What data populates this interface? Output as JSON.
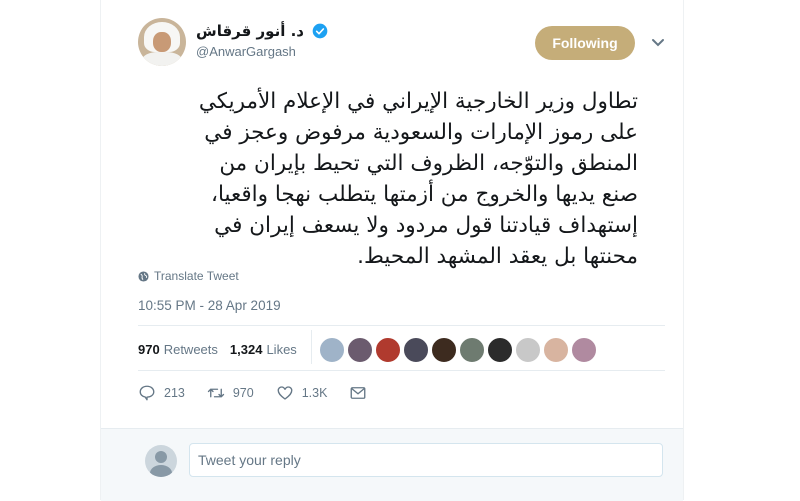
{
  "author": {
    "display_name": "د. أنور قرقاش",
    "handle": "@AnwarGargash",
    "verified": true,
    "avatar_icon": "profile-photo"
  },
  "follow_button": {
    "label": "Following",
    "color": "#c5ad79"
  },
  "tweet": {
    "lines": [
      "تطاول وزير الخارجية الإيراني في الإعلام الأمريكي",
      "على رموز الإمارات والسعودية مرفوض وعجز في",
      "المنطق والتوّجه، الظروف التي تحيط بإيران من",
      "صنع يديها والخروج من أزمتها يتطلب نهجا واقعيا،",
      "إستهداف قيادتنا قول مردود ولا يسعف إيران في",
      "محنتها بل يعقد المشهد المحيط."
    ]
  },
  "translate_label": "Translate Tweet",
  "timestamp": "10:55 PM - 28 Apr 2019",
  "stats": {
    "retweets_count": "970",
    "retweets_label": "Retweets",
    "likes_count": "1,324",
    "likes_label": "Likes"
  },
  "liker_avatar_colors": [
    "#9fb3c8",
    "#6b5b6e",
    "#b03a2e",
    "#4a4a5a",
    "#3d2b1f",
    "#6e7b70",
    "#2b2b2b",
    "#c8c8c8",
    "#d8b4a0",
    "#b08aa0"
  ],
  "actions": {
    "replies": "213",
    "retweets": "970",
    "likes": "1.3K"
  },
  "reply": {
    "placeholder": "Tweet your reply"
  },
  "colors": {
    "verified": "#1da1f2",
    "text": "#14171a",
    "muted": "#657786"
  }
}
